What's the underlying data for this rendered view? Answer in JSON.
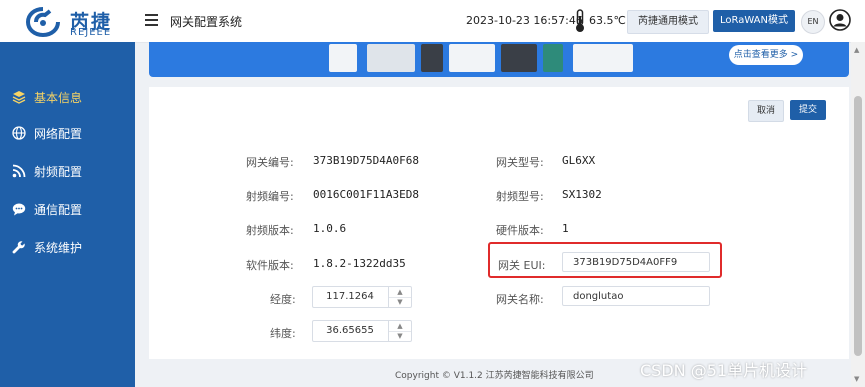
{
  "header": {
    "logo_cn": "芮捷",
    "logo_en": "REJEEE",
    "system_title": "网关配置系统",
    "datetime": "2023-10-23 16:57:46",
    "temperature": "63.5℃",
    "mode_generic": "芮捷通用模式",
    "mode_lorawan": "LoRaWAN模式",
    "language": "EN"
  },
  "sidebar": {
    "items": [
      {
        "label": "基本信息",
        "icon": "layers-icon",
        "active": true
      },
      {
        "label": "网络配置",
        "icon": "globe-icon",
        "active": false
      },
      {
        "label": "射频配置",
        "icon": "rss-icon",
        "active": false
      },
      {
        "label": "通信配置",
        "icon": "chat-icon",
        "active": false
      },
      {
        "label": "系统维护",
        "icon": "wrench-icon",
        "active": false
      }
    ]
  },
  "banner": {
    "button_label": "点击查看更多 >"
  },
  "actions": {
    "cancel": "取消",
    "submit": "提交"
  },
  "info": {
    "gateway_id_label": "网关编号:",
    "gateway_id": "373B19D75D4A0F68",
    "gateway_model_label": "网关型号:",
    "gateway_model": "GL6XX",
    "rf_id_label": "射频编号:",
    "rf_id": "0016C001F11A3ED8",
    "rf_model_label": "射频型号:",
    "rf_model": "SX1302",
    "rf_version_label": "射频版本:",
    "rf_version": "1.0.6",
    "hw_version_label": "硬件版本:",
    "hw_version": "1",
    "sw_version_label": "软件版本:",
    "sw_version": "1.8.2-1322dd35",
    "eui_label": "网关 EUI:",
    "eui": "373B19D75D4A0FF9",
    "longitude_label": "经度:",
    "longitude": "117.1264",
    "gateway_name_label": "网关名称:",
    "gateway_name": "donglutao",
    "latitude_label": "纬度:",
    "latitude": "36.65655"
  },
  "footer": {
    "copyright": "Copyright © V1.1.2 江苏芮捷智能科技有限公司"
  },
  "watermark": "CSDN @51单片机设计",
  "colors": {
    "brand": "#1f5fa8",
    "active_nav": "#f6d365",
    "highlight": "#e02b2b"
  }
}
